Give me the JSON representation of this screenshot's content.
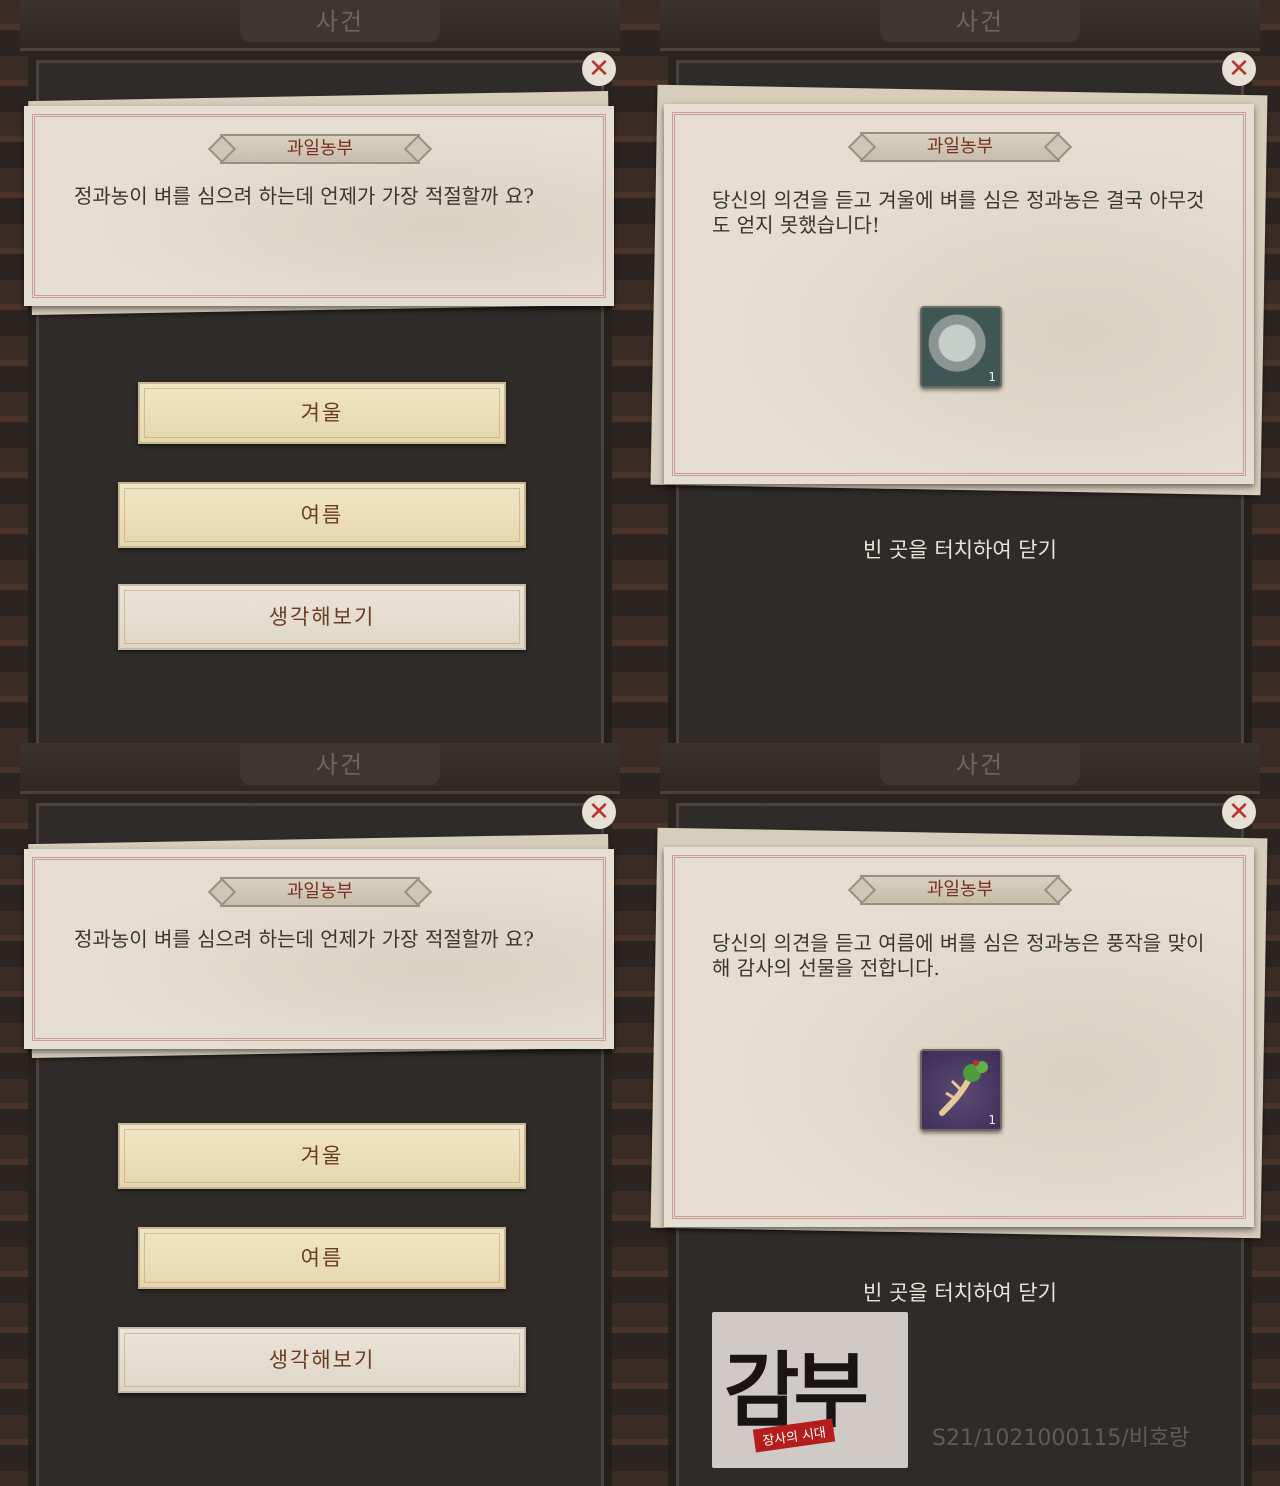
{
  "header": {
    "title": "사건"
  },
  "event": {
    "title": "과일농부",
    "question": "정과농이 벼를 심으려 하는데 언제가 가장 적절할까 요?"
  },
  "choices": {
    "winter": "겨울",
    "summer": "여름",
    "think": "생각해보기"
  },
  "result_winter": {
    "text": "당신의 의견을 듣고 겨울에 벼를 심은 정과농은 결국 아무것도 얻지 못했습니다!",
    "reward_icon": "silver-coin-icon",
    "reward_count": "1"
  },
  "result_summer": {
    "text": "당신의 의견을 듣고 여름에 벼를 심은 정과농은 풍작을 맞이해 감사의 선물을 전합니다.",
    "reward_icon": "ginseng-icon",
    "reward_count": "1"
  },
  "close_hint": "빈 곳을 터치하여 닫기",
  "logo": {
    "main": "감부",
    "sub": "장사의 시대"
  },
  "watermark": "S21/1021000115/비호랑",
  "colors": {
    "gold_button": "#efe3c3",
    "plain_button": "#e8e1d4",
    "title_text": "#7a2f1c"
  }
}
